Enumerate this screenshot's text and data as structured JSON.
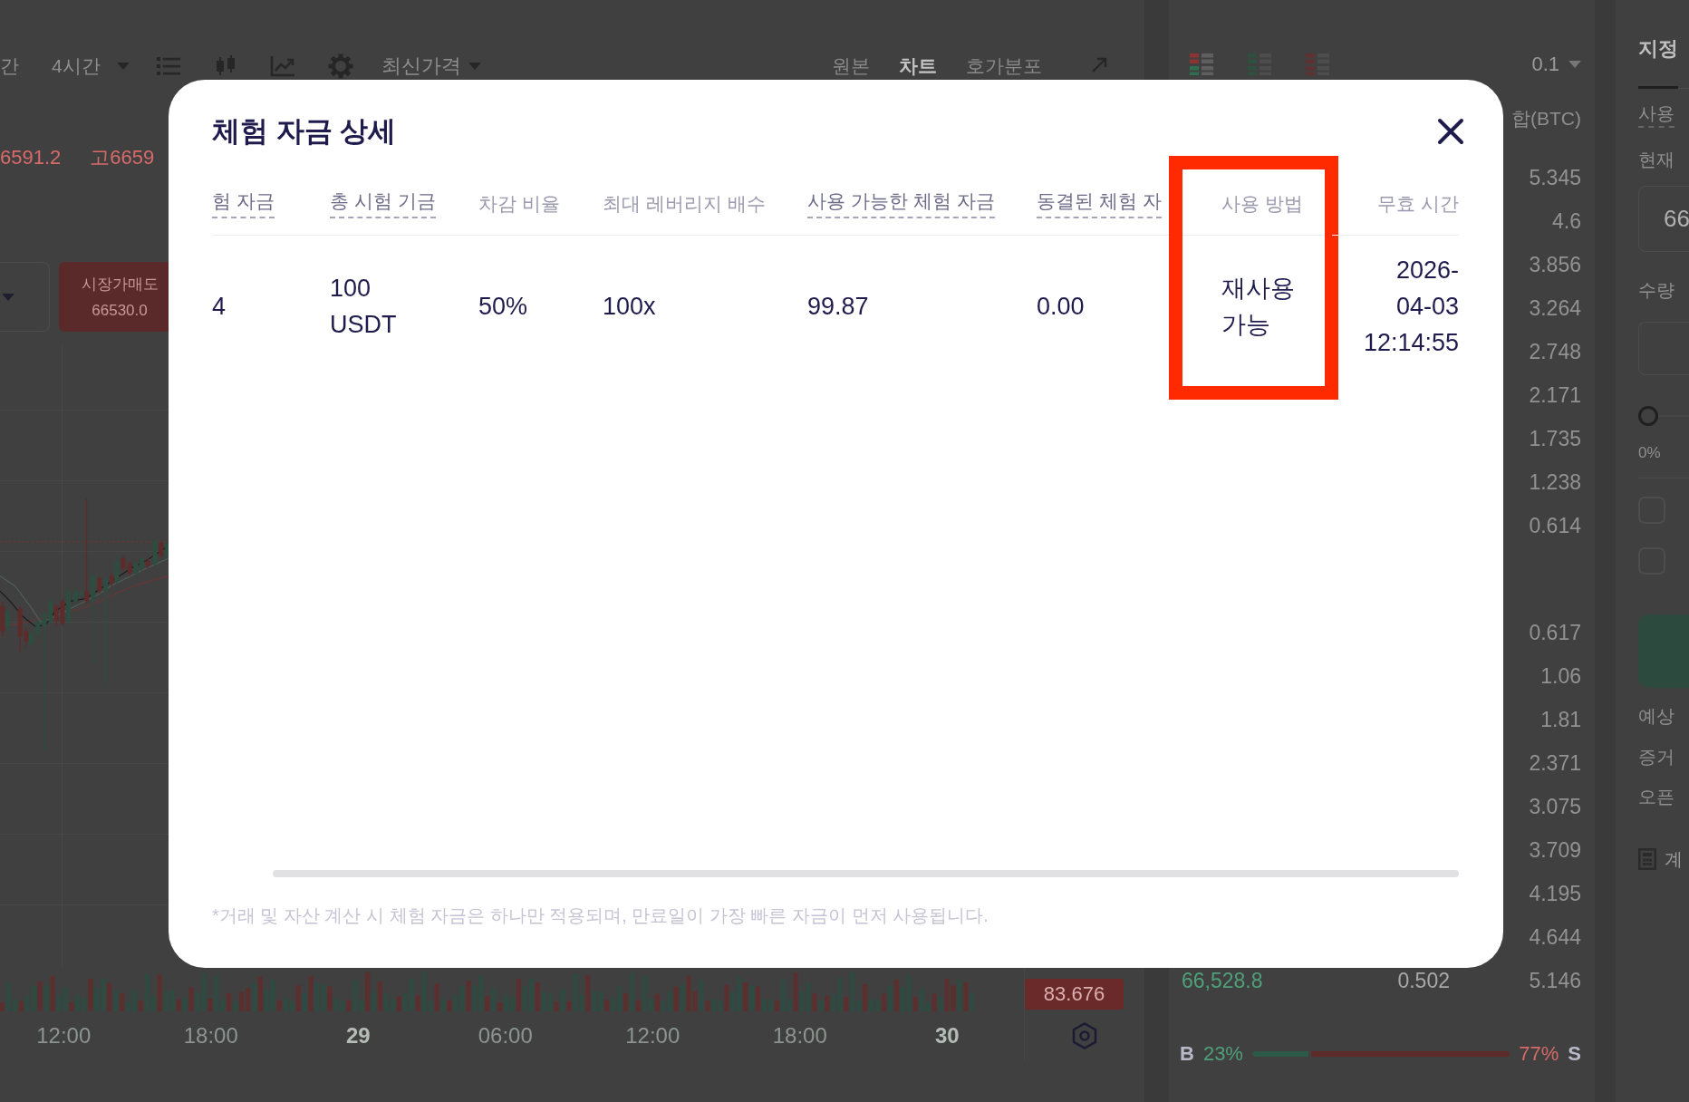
{
  "chart_panel": {
    "intervals": [
      "간",
      "4시간"
    ],
    "price_source": "최신가격",
    "views": [
      {
        "label": "원본",
        "selected": false
      },
      {
        "label": "차트",
        "selected": true
      },
      {
        "label": "호가분포",
        "selected": false
      }
    ],
    "stats": [
      "6591.2",
      "고6659"
    ],
    "sell_button": {
      "label": "시장가매도",
      "price": "66530.0"
    },
    "price_tag": "83.676",
    "time_axis": [
      {
        "label": "12:00",
        "kind": "time"
      },
      {
        "label": "18:00",
        "kind": "time"
      },
      {
        "label": "29",
        "kind": "date"
      },
      {
        "label": "06:00",
        "kind": "time"
      },
      {
        "label": "12:00",
        "kind": "time"
      },
      {
        "label": "18:00",
        "kind": "time"
      },
      {
        "label": "30",
        "kind": "date"
      }
    ]
  },
  "order_book": {
    "layouts": [
      {
        "kind": "both",
        "selected": true
      },
      {
        "kind": "bids",
        "selected": false
      },
      {
        "kind": "asks",
        "selected": false
      }
    ],
    "step": "0.1",
    "total_header": "합(BTC)",
    "asks": [
      {
        "total": "5.345"
      },
      {
        "total": "4.6"
      },
      {
        "total": "3.856"
      },
      {
        "total": "3.264"
      },
      {
        "total": "2.748"
      },
      {
        "total": "2.171"
      },
      {
        "total": "1.735"
      },
      {
        "total": "1.238"
      },
      {
        "total": "0.614"
      }
    ],
    "bids": [
      {
        "total": "0.617"
      },
      {
        "total": "1.06"
      },
      {
        "total": "1.81"
      },
      {
        "total": "2.371"
      },
      {
        "total": "3.075"
      },
      {
        "total": "3.709"
      },
      {
        "total": "4.195"
      },
      {
        "total": "4.644"
      },
      {
        "price": "66,528.8",
        "amount": "0.502",
        "total": "5.146"
      }
    ],
    "ratio": {
      "buy_label": "B",
      "buy_percent": "23%",
      "sell_percent": "77%",
      "sell_label": "S",
      "level": 0.23
    }
  },
  "order_form": {
    "order_type": "지정",
    "balance_label": "사용",
    "price_label": "현재",
    "price_value": "66",
    "quantity_label": "수량",
    "slider": {
      "level": 0,
      "reading": "0%"
    },
    "options": [
      {
        "checked": false
      },
      {
        "checked": false
      }
    ],
    "notes": [
      "예상",
      "증거",
      "오픈"
    ],
    "calculator_label": "계"
  },
  "modal": {
    "title": "체험 자금 상세",
    "columns": [
      {
        "label": "험 자금",
        "has_tooltip": true,
        "highlighted": false
      },
      {
        "label": "총 시험 기금",
        "has_tooltip": true,
        "highlighted": false
      },
      {
        "label": "차감 비율",
        "has_tooltip": false,
        "highlighted": false
      },
      {
        "label": "최대 레버리지 배수",
        "has_tooltip": false,
        "highlighted": false
      },
      {
        "label": "사용 가능한 체험 자금",
        "has_tooltip": true,
        "highlighted": false
      },
      {
        "label": "동결된 체험 자",
        "has_tooltip": true,
        "highlighted": false
      },
      {
        "label": "사용 방법",
        "has_tooltip": false,
        "highlighted": true
      },
      {
        "label": "무효 시간",
        "has_tooltip": false,
        "highlighted": false
      }
    ],
    "rows": [
      {
        "cells": [
          "4",
          "100 USDT",
          "50%",
          "100x",
          "99.87",
          "0.00",
          "재사용 가능",
          "2026-04-03 12:14:55"
        ]
      }
    ],
    "note": "*거래 및 자산 계산 시 체험 자금은 하나만 적용되며, 만료일이 가장 빠른 자금이 먼저 사용됩니다."
  }
}
